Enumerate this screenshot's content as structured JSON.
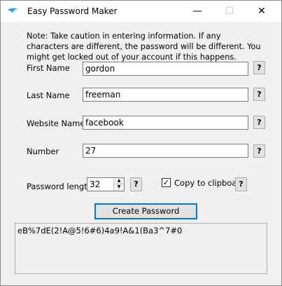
{
  "window": {
    "title": "Easy Password Maker",
    "controls": {
      "minimize": "—",
      "maximize": "☐",
      "close": "✕"
    }
  },
  "note": "Note: Take caution in entering information. If any characters are different, the password will be different. You might get locked out of your account if this happens.",
  "fields": {
    "first_name": {
      "label": "First Name",
      "value": "gordon"
    },
    "last_name": {
      "label": "Last Name",
      "value": "freeman"
    },
    "website_name": {
      "label": "Website Name",
      "value": "facebook"
    },
    "number": {
      "label": "Number",
      "value": "27"
    }
  },
  "help_label": "?",
  "password_length": {
    "label": "Password length",
    "value": "32"
  },
  "copy_to_clipboard": {
    "label": "Copy to clipboard",
    "checked": true,
    "mark": "✓"
  },
  "create_button": "Create Password",
  "output": "eB%7dE(2!A@5!6#6)4a9!A&1(Ba3^7#0"
}
